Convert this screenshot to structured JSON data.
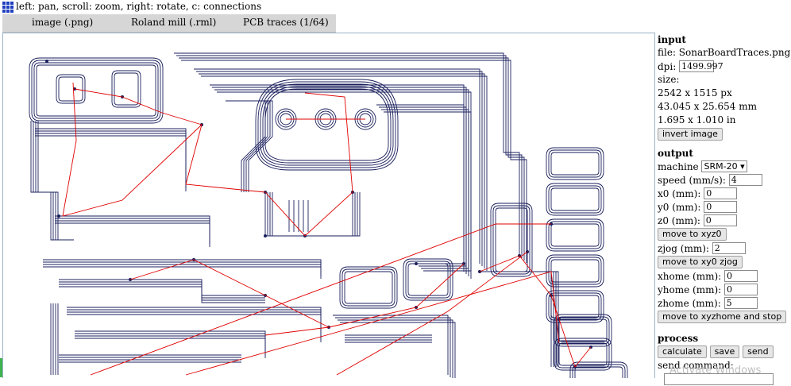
{
  "header": {
    "hint": "left: pan, scroll: zoom, right: rotate, c: connections"
  },
  "tabs": [
    {
      "label": "image (.png)"
    },
    {
      "label": "Roland mill (.rml)"
    },
    {
      "label": "PCB traces (1/64)"
    }
  ],
  "input": {
    "title": "input",
    "file_line": "file: SonarBoardTraces.png",
    "dpi_label": "dpi:",
    "dpi_value": "1499.997",
    "size_label": "size:",
    "size_px": "2542 x 1515 px",
    "size_mm": "43.045 x 25.654 mm",
    "size_in": "1.695 x 1.010 in",
    "invert_button": "invert image"
  },
  "output": {
    "title": "output",
    "machine_label": "machine",
    "machine_value": "SRM-20",
    "speed_label": "speed (mm/s):",
    "speed_value": "4",
    "x0_label": "x0 (mm):",
    "x0_value": "0",
    "y0_label": "y0 (mm):",
    "y0_value": "0",
    "z0_label": "z0 (mm):",
    "z0_value": "0",
    "move_xyz0_button": "move to xyz0",
    "zjog_label": "zjog (mm):",
    "zjog_value": "2",
    "move_xy0_zjog_button": "move to xy0 zjog",
    "xhome_label": "xhome (mm):",
    "xhome_value": "0",
    "yhome_label": "yhome (mm):",
    "yhome_value": "0",
    "zhome_label": "zhome (mm):",
    "zhome_value": "5",
    "move_home_button": "move to xyzhome and stop"
  },
  "process": {
    "title": "process",
    "calculate_button": "calculate",
    "save_button": "save",
    "send_button": "send",
    "send_command_label": "send command:",
    "send_command_value": ""
  },
  "watermark": "Activate Windows",
  "colors": {
    "trace": "#1a1f5c",
    "connection": "#e00000",
    "tabbar": "#d6d6d6",
    "canvas_border": "#9ab3c8",
    "icon": "#1f3fbf"
  }
}
